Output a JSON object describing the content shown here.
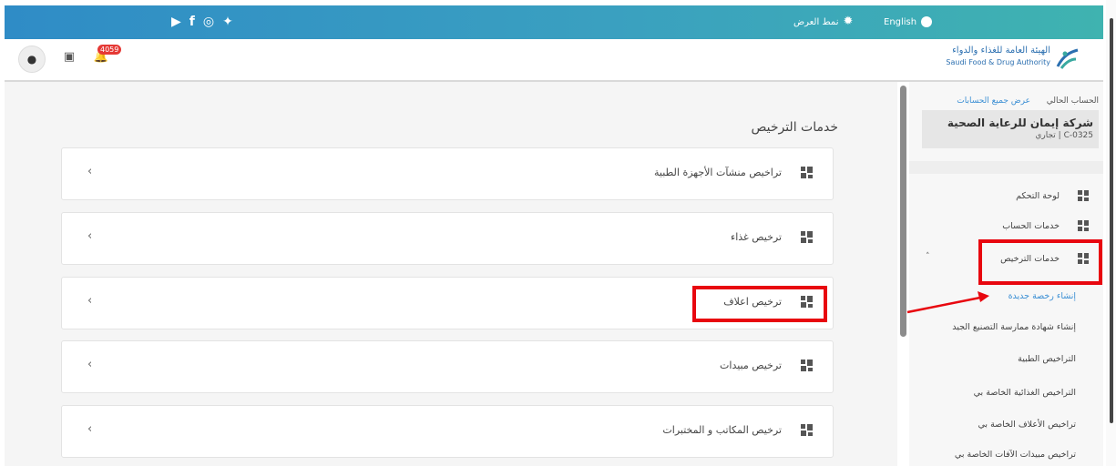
{
  "topbar": {
    "social_icons": [
      "youtube-icon",
      "facebook-icon",
      "instagram-icon",
      "twitter-icon"
    ],
    "display_mode_label": "نمط العرض",
    "language_label": "English"
  },
  "header": {
    "notification_count": "4059",
    "logo_arabic": "الهيئة العامة للغذاء والدواء",
    "logo_english": "Saudi Food & Drug Authority"
  },
  "main": {
    "title": "خدمات الترخيص",
    "cards": [
      {
        "label": "تراخيص منشآت الأجهزة الطبية"
      },
      {
        "label": "ترخيص غذاء"
      },
      {
        "label": "ترخيص اعلاف"
      },
      {
        "label": "ترخيص مبيدات"
      },
      {
        "label": "ترخيص المكاتب و المختبرات"
      }
    ]
  },
  "sidebar": {
    "current_account_label": "الحساب الحالي",
    "all_accounts_link": "عرض جميع الحسابات",
    "company_name": "شركة إيمان للرعاية الصحية",
    "company_sub": "C-0325 | تجاري",
    "nav": [
      {
        "label": "لوحة التحكم"
      },
      {
        "label": "خدمات الحساب"
      },
      {
        "label": "خدمات الترخيص"
      }
    ],
    "sub_items": [
      {
        "label": "إنشاء رخصة جديدة"
      },
      {
        "label": "إنشاء شهادة ممارسة التصنيع الجيد"
      },
      {
        "label": "التراخيص الطبية"
      },
      {
        "label": "التراخيص الغذائية الخاصة بي"
      },
      {
        "label": "تراخيص الأعلاف الخاصة بي"
      },
      {
        "label": "تراخيص مبيدات الآفات الخاصة بي"
      }
    ]
  },
  "colors": {
    "topbar_start": "#2f8cc6",
    "topbar_end": "#3fb3b0",
    "highlight": "#e8070f",
    "link": "#3b8fd4",
    "badge": "#e53935"
  }
}
